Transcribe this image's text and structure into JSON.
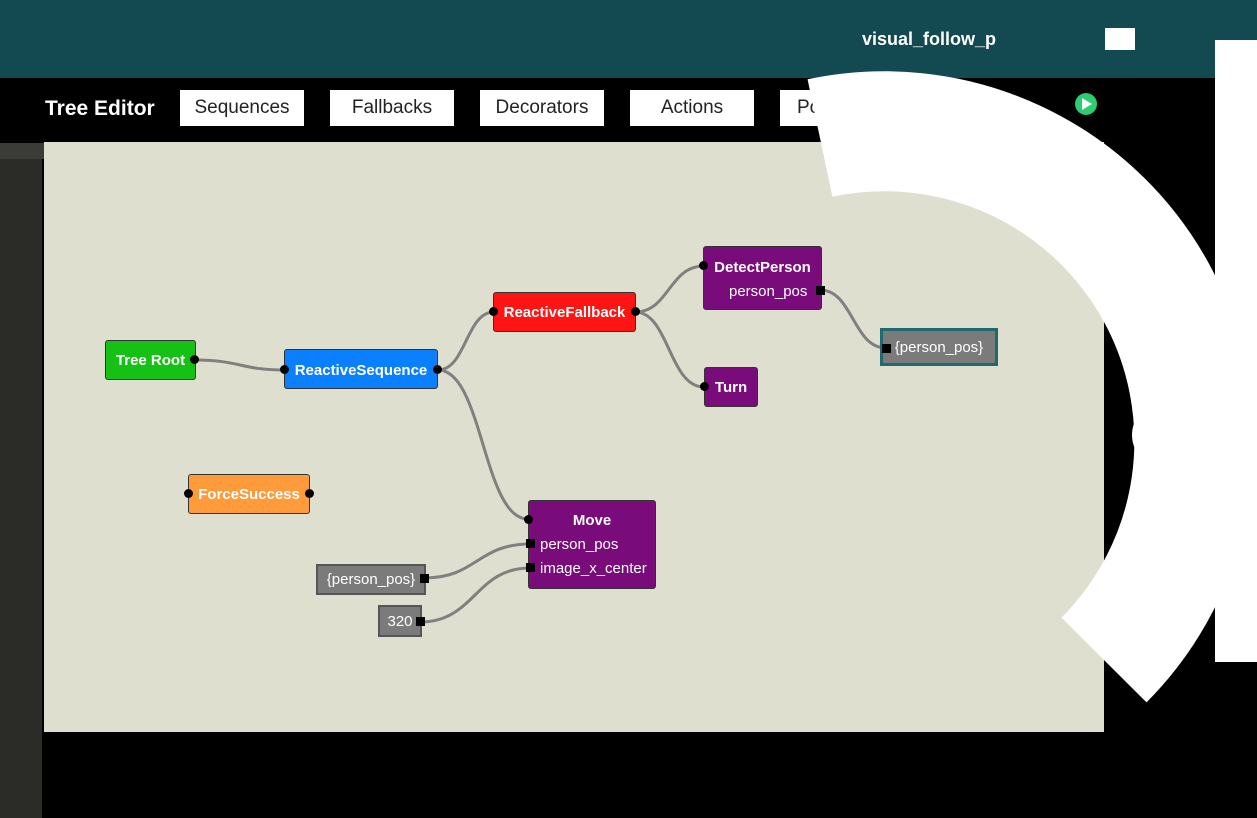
{
  "header": {
    "title": "visual_follow_p"
  },
  "toolbar": {
    "title": "Tree Editor",
    "buttons": [
      "Sequences",
      "Fallbacks",
      "Decorators",
      "Actions",
      "Port val"
    ]
  },
  "tree": {
    "root": "Tree Root",
    "reactive_sequence": "ReactiveSequence",
    "reactive_fallback": "ReactiveFallback",
    "detect_person": {
      "label": "DetectPerson",
      "port": "person_pos"
    },
    "turn": "Turn",
    "force_success": "ForceSuccess",
    "move": {
      "label": "Move",
      "ports": [
        "person_pos",
        "image_x_center"
      ]
    },
    "values": {
      "detect_output": "{person_pos}",
      "move_person_pos": "{person_pos}",
      "move_image_x_center": "320"
    }
  },
  "colors": {
    "header": "#134950",
    "root": "#16c116",
    "sequence": "#0a80ff",
    "fallback": "#ff1414",
    "action": "#7a0b7a",
    "decorator": "#ff9b3a",
    "value": "#7b7b7b"
  }
}
